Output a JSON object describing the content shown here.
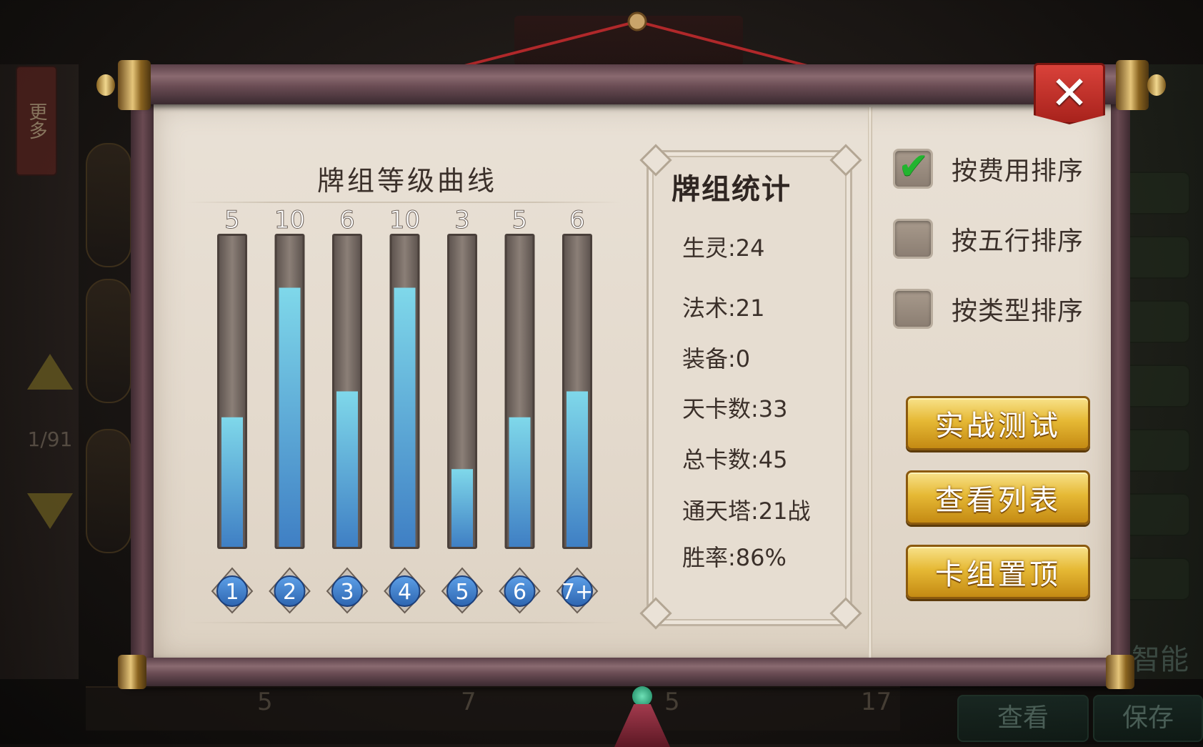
{
  "background": {
    "more_label": "更多",
    "page_indicator": "1/91",
    "bottom_numbers": [
      "5",
      "7",
      "5",
      "17"
    ],
    "bottom_buttons": [
      "查看",
      "保存"
    ],
    "right_side_label": "智能"
  },
  "dialog": {
    "close_label": "✕",
    "chart_title": "牌组等级曲线",
    "stats_title": "牌组统计",
    "stats": [
      {
        "label": "生灵:24"
      },
      {
        "label": "法术:21"
      },
      {
        "label": "装备:0"
      },
      {
        "label": "天卡数:33"
      },
      {
        "label": "总卡数:45"
      },
      {
        "label": "通天塔:21战"
      },
      {
        "label": "胜率:86%"
      }
    ],
    "sort_options": [
      {
        "label": "按费用排序",
        "checked": true
      },
      {
        "label": "按五行排序",
        "checked": false
      },
      {
        "label": "按类型排序",
        "checked": false
      }
    ],
    "buttons": {
      "battle_test": "实战测试",
      "view_list": "查看列表",
      "pin_deck": "卡组置顶"
    }
  },
  "chart_data": {
    "type": "bar",
    "title": "牌组等级曲线",
    "categories": [
      "1",
      "2",
      "3",
      "4",
      "5",
      "6",
      "7+"
    ],
    "values": [
      5,
      10,
      6,
      10,
      3,
      5,
      6
    ],
    "ylim": [
      0,
      12
    ],
    "colors": {
      "fill_top": "#7fd8ea",
      "fill_bottom": "#3f7fc4",
      "track": "#8b7f77",
      "badge": "#2d65b0"
    }
  }
}
